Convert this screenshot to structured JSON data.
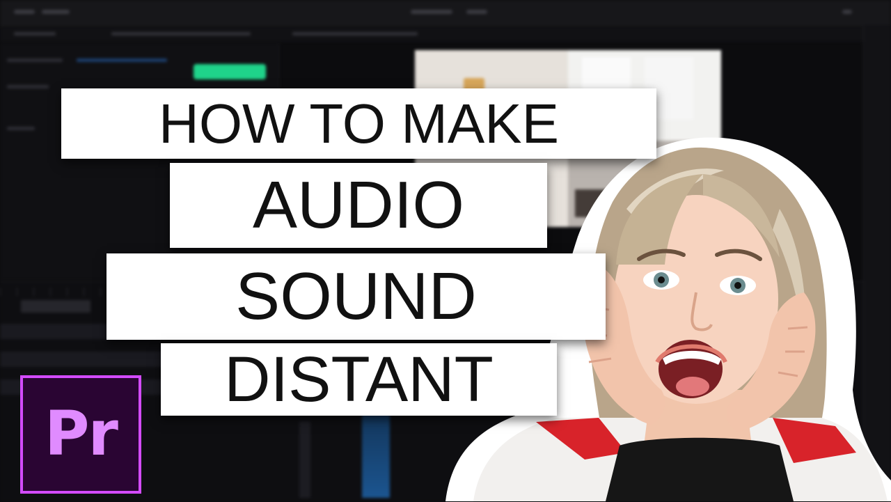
{
  "thumbnail": {
    "title_lines": [
      "HOW TO MAKE",
      "AUDIO",
      "SOUND",
      "DISTANT"
    ],
    "logo_text": "Pr",
    "logo_colors": {
      "background": "#2a0533",
      "border": "#d34bff",
      "text": "#e08bff"
    },
    "accent_color": "#1fd38a",
    "banner_color": "#ffffff",
    "banner_text_color": "#111111"
  },
  "icons": {
    "logo": "adobe-premiere-pro-icon",
    "person": "excited-woman-cutout"
  }
}
